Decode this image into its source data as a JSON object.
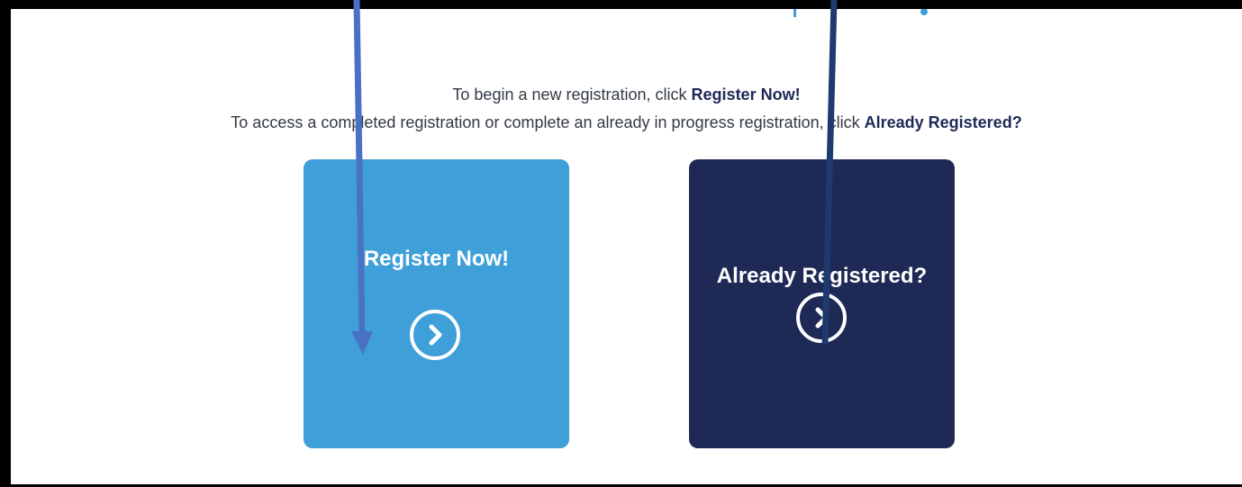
{
  "instructions": {
    "line1_prefix": "To begin a new registration, click ",
    "line1_bold": "Register Now!",
    "line2_prefix": "To access a completed registration or complete an already in progress registration, click ",
    "line2_bold": "Already Registered?"
  },
  "cards": [
    {
      "label": "Register Now!",
      "icon": "chevron-right-circle-icon",
      "color": "#3fa0d9"
    },
    {
      "label": "Already Registered?",
      "icon": "chevron-right-circle-icon",
      "color": "#1e2956"
    }
  ],
  "colors": {
    "frame": "#000000",
    "text": "#333a45",
    "emphasis": "#1e2956",
    "logo_accent": "#3fa0d9",
    "annotation_arrow_left": "#4a72c4",
    "annotation_arrow_right": "#1e3a6e"
  }
}
